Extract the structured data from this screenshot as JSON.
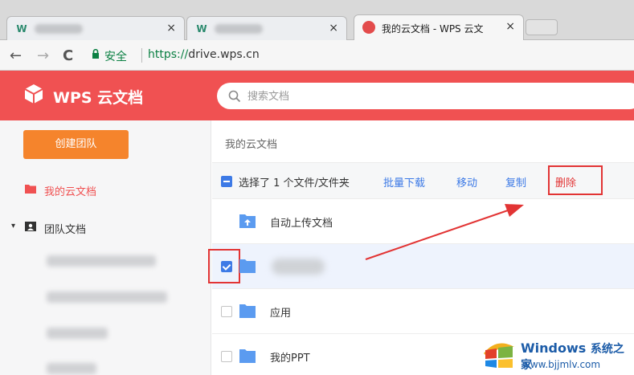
{
  "browser": {
    "tabs": [
      {
        "label": "",
        "close": "×"
      },
      {
        "label": "",
        "close": "×"
      },
      {
        "label": "我的云文档 - WPS 云文 ",
        "close": "×"
      }
    ],
    "nav": {
      "back": "←",
      "forward": "→",
      "reload": "C"
    },
    "secure_label": "安全",
    "url_scheme": "https://",
    "url_host": "drive.wps.cn"
  },
  "app": {
    "logo_text": "WPS 云文档",
    "search_placeholder": "搜索文档"
  },
  "sidebar": {
    "create_team_label": "创建团队",
    "my_docs_label": "我的云文档",
    "team_docs_label": "团队文档",
    "team_toggle": "▾"
  },
  "main": {
    "breadcrumb": "我的云文档",
    "toolbar": {
      "selection_text": "选择了 1 个文件/文件夹",
      "download": "批量下载",
      "move": "移动",
      "copy": "复制",
      "delete": "删除"
    },
    "rows": [
      {
        "name": "自动上传文档",
        "checked": false
      },
      {
        "name": "",
        "checked": true
      },
      {
        "name": "应用",
        "checked": false
      },
      {
        "name": "我的PPT",
        "checked": false
      }
    ]
  },
  "watermark": {
    "brand": "Windows",
    "brand_cn": "系统之家",
    "url": "www.bjjmlv.com"
  },
  "colors": {
    "header_red": "#f05152",
    "accent_blue": "#3d7ae6",
    "orange": "#f5842c",
    "highlight_red": "#e23434"
  }
}
